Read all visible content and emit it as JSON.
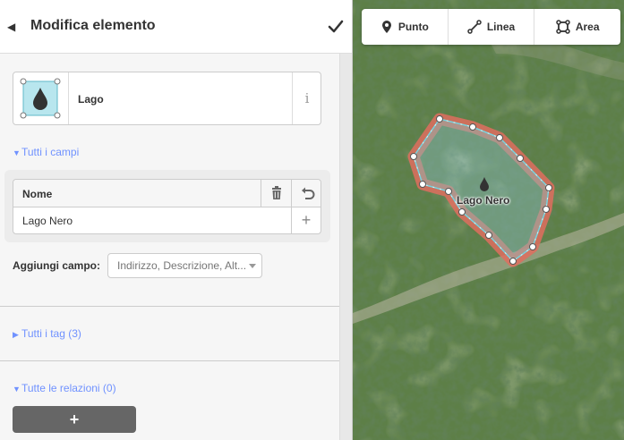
{
  "sidebar": {
    "title": "Modifica elemento",
    "preset": {
      "name": "Lago",
      "icon": "water-drop-icon"
    },
    "all_fields_label": "Tutti i campi",
    "field": {
      "label": "Nome",
      "value": "Lago Nero"
    },
    "add_field_label": "Aggiungi campo:",
    "add_field_placeholder": "Indirizzo, Descrizione, Alt...",
    "all_tags_label": "Tutti i tag (3)",
    "all_relations_label": "Tutte le relazioni (0)"
  },
  "toolbar": {
    "modes": [
      {
        "label": "Punto",
        "icon": "point-pin-icon"
      },
      {
        "label": "Linea",
        "icon": "line-icon"
      },
      {
        "label": "Area",
        "icon": "area-icon"
      }
    ]
  },
  "map": {
    "feature_label": "Lago Nero",
    "colors": {
      "selection": "#e06e5f",
      "water": "#77d3de",
      "vertex": "#ffffff"
    }
  }
}
